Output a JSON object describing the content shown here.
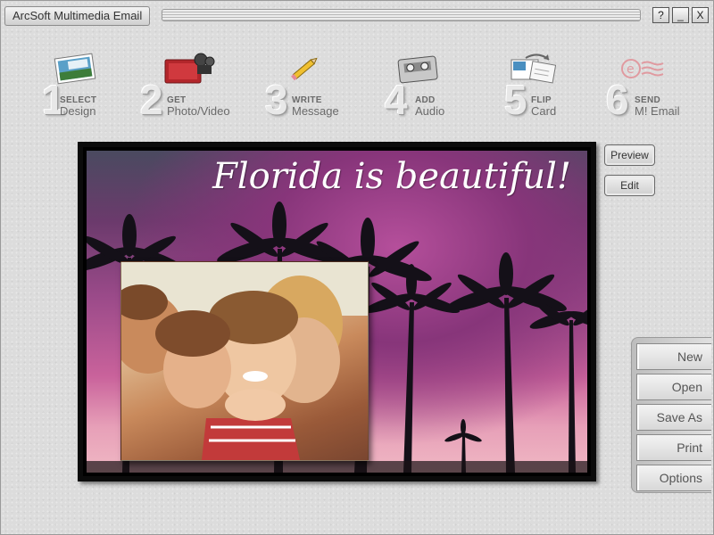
{
  "window": {
    "title": "ArcSoft Multimedia Email",
    "controls": {
      "help": "?",
      "minimize": "_",
      "close": "X"
    }
  },
  "steps": [
    {
      "number": "1",
      "verb": "SELECT",
      "noun": "Design",
      "icon": "postcard-icon"
    },
    {
      "number": "2",
      "verb": "GET",
      "noun": "Photo/Video",
      "icon": "camera-album-icon"
    },
    {
      "number": "3",
      "verb": "WRITE",
      "noun": "Message",
      "icon": "pencil-icon"
    },
    {
      "number": "4",
      "verb": "ADD",
      "noun": "Audio",
      "icon": "cassette-icon"
    },
    {
      "number": "5",
      "verb": "FLIP",
      "noun": "Card",
      "icon": "flip-card-icon"
    },
    {
      "number": "6",
      "verb": "SEND",
      "noun": "M! Email",
      "icon": "email-stamp-icon"
    }
  ],
  "card": {
    "headline": "Florida is beautiful!"
  },
  "side_buttons": {
    "preview": "Preview",
    "edit": "Edit"
  },
  "file_panel": {
    "new": "New",
    "open": "Open",
    "save_as": "Save As",
    "print": "Print",
    "options": "Options"
  },
  "colors": {
    "window_bg": "#dcdcdc",
    "sky_purple": "#9a4a89",
    "sky_pink": "#e7a0b8"
  }
}
